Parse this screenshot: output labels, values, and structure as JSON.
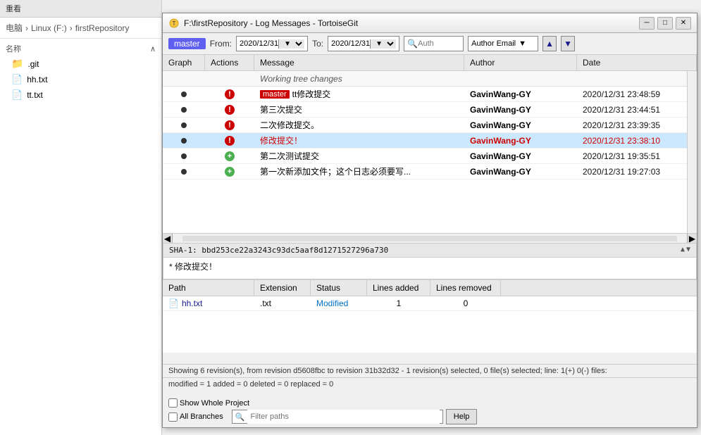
{
  "explorer": {
    "title": "重看",
    "breadcrumb": [
      "电脑",
      "Linux (F:)",
      "firstRepository"
    ],
    "nav_header": "名称",
    "items": [
      {
        "name": ".git",
        "type": "folder"
      },
      {
        "name": "hh.txt",
        "type": "file"
      },
      {
        "name": "tt.txt",
        "type": "file"
      }
    ]
  },
  "window": {
    "title": "F:\\firstRepository - Log Messages - TortoiseGit",
    "min_btn": "─",
    "max_btn": "□",
    "close_btn": "✕"
  },
  "toolbar": {
    "branch": "master",
    "from_label": "From:",
    "from_date": "2020/12/31",
    "to_label": "To:",
    "to_date": "2020/12/31",
    "search_placeholder": "Auth",
    "author_email_label": "Author Email",
    "up_arrow": "▲",
    "down_arrow": "▼"
  },
  "log_columns": {
    "graph": "Graph",
    "actions": "Actions",
    "message": "Message",
    "author": "Author",
    "date": "Date"
  },
  "working_tree": {
    "message": "Working tree changes"
  },
  "log_entries": [
    {
      "id": 1,
      "has_dot": true,
      "action": "error",
      "has_master_tag": true,
      "message": "tt修改提交",
      "author": "GavinWang-GY",
      "date": "2020/12/31 23:48:59",
      "date_red": true,
      "selected": false
    },
    {
      "id": 2,
      "has_dot": true,
      "action": "error",
      "has_master_tag": false,
      "message": "第三次提交",
      "author": "GavinWang-GY",
      "date": "2020/12/31 23:44:51",
      "date_red": false,
      "selected": false
    },
    {
      "id": 3,
      "has_dot": true,
      "action": "error",
      "has_master_tag": false,
      "message": "二次修改提交。",
      "author": "GavinWang-GY",
      "date": "2020/12/31 23:39:35",
      "date_red": false,
      "selected": false
    },
    {
      "id": 4,
      "has_dot": true,
      "action": "error",
      "has_master_tag": false,
      "message": "修改提交！",
      "author": "GavinWang-GY",
      "date": "2020/12/31 23:38:10",
      "date_red": true,
      "selected": true
    },
    {
      "id": 5,
      "has_dot": true,
      "action": "plus",
      "has_master_tag": false,
      "message": "第二次测试提交",
      "author": "GavinWang-GY",
      "date": "2020/12/31 19:35:51",
      "date_red": false,
      "selected": false
    },
    {
      "id": 6,
      "has_dot": true,
      "action": "plus",
      "has_master_tag": false,
      "message": "第一次新添加文件；这个日志必须要写...",
      "author": "GavinWang-GY",
      "date": "2020/12/31 19:27:03",
      "date_red": false,
      "selected": false
    }
  ],
  "sha_section": {
    "sha_label": "SHA-1:",
    "sha_value": "bbd253ce22a3243c93dc5aaf8d1271527296a730",
    "commit_message": "* 修改提交！"
  },
  "file_columns": {
    "path": "Path",
    "extension": "Extension",
    "status": "Status",
    "lines_added": "Lines added",
    "lines_removed": "Lines removed"
  },
  "file_entries": [
    {
      "path": "hh.txt",
      "extension": ".txt",
      "status": "Modified",
      "lines_added": "1",
      "lines_removed": "0"
    }
  ],
  "status_bar": {
    "line1": "Showing 6 revision(s), from revision d5608fbc to revision 31b32d32 - 1 revision(s) selected, 0 file(s) selected; line: 1(+) 0(-) files:",
    "line2": "modified = 1 added = 0 deleted = 0 replaced = 0",
    "checkbox1": "Show Whole Project",
    "checkbox2": "All Branches",
    "filter_placeholder": "Filter paths",
    "help_btn": "Help",
    "search_icon": "🔍"
  }
}
